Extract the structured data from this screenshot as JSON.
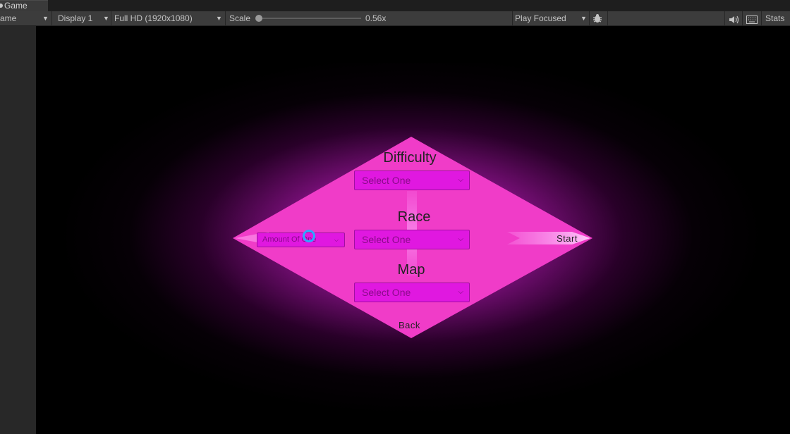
{
  "tabs": {
    "game_tab": "Game"
  },
  "toolbar": {
    "view_selector": "ame",
    "display": "Display 1",
    "resolution": "Full HD (1920x1080)",
    "scale_label": "Scale",
    "scale_value": "0.56x",
    "scale_fraction": 0.05,
    "play_mode": "Play Focused",
    "stats": "Stats",
    "icons": [
      "bug-icon",
      "speaker-icon",
      "keyboard-icon"
    ]
  },
  "menu": {
    "difficulty_label": "Difficulty",
    "difficulty_value": "Select One",
    "race_label": "Race",
    "race_value": "Select One",
    "map_label": "Map",
    "map_value": "Select One",
    "amount_value": "Amount Of One",
    "start": "Start",
    "back": "Back"
  },
  "colors": {
    "accent": "#ff4fe0",
    "dropdown": "#e018e0",
    "cursor": "#2ea7ff"
  }
}
